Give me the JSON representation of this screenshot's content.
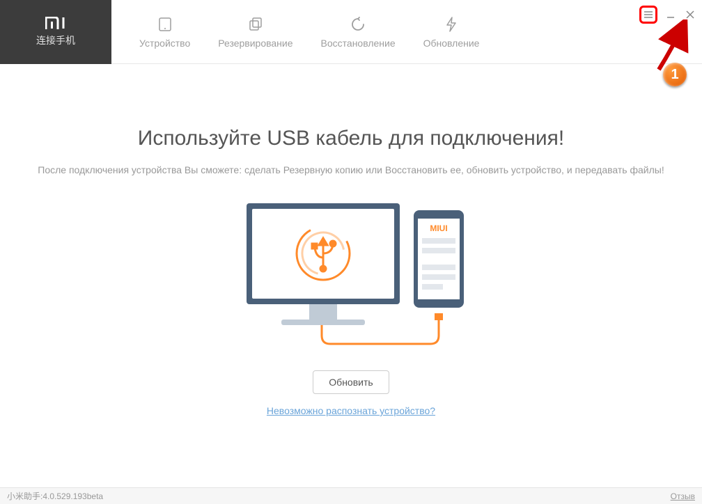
{
  "brand": {
    "logo_text": "MI",
    "label": "连接手机"
  },
  "nav": {
    "device": "Устройство",
    "backup": "Резервирование",
    "restore": "Восстановление",
    "update": "Обновление"
  },
  "annotation": {
    "step_number": "1"
  },
  "main": {
    "title": "Используйте USB кабель для подключения!",
    "subtitle": "После подключения устройства Вы сможете: сделать Резервную копию или Восстановить ее, обновить устройство, и передавать файлы!",
    "refresh_label": "Обновить",
    "help_link": "Невозможно распознать устройство?",
    "phone_label": "MIUI"
  },
  "footer": {
    "version": "小米助手:4.0.529.193beta",
    "feedback": "Отзыв"
  }
}
